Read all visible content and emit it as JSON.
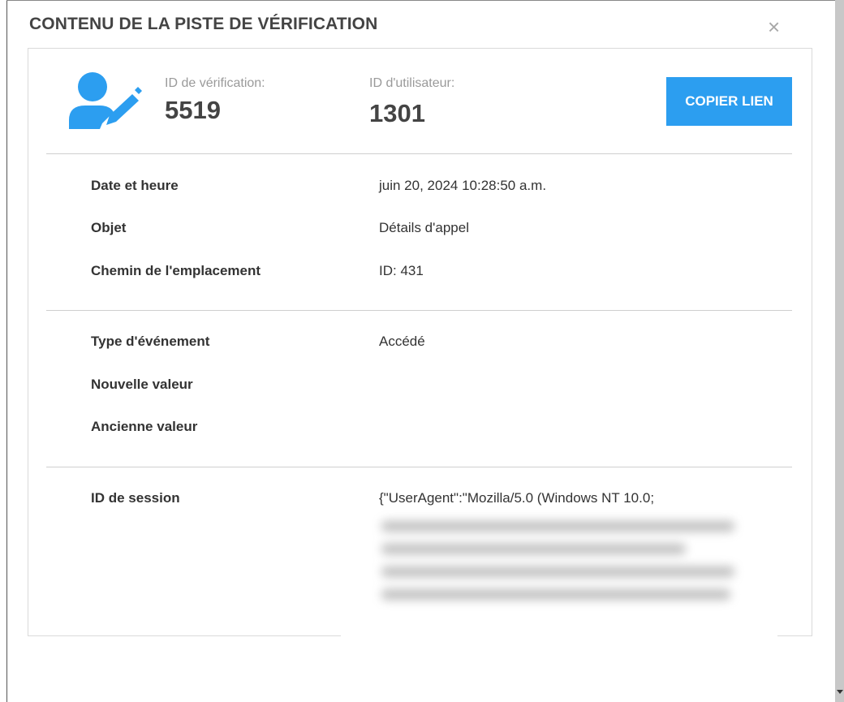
{
  "dialog": {
    "title": "CONTENU DE LA PISTE DE VÉRIFICATION",
    "close_glyph": "×"
  },
  "header": {
    "icon": "user-edit-icon",
    "verification_label": "ID de vérification:",
    "verification_id": "5519",
    "user_label": "ID d'utilisateur:",
    "user_id": "1301",
    "copy_button": "COPIER LIEN",
    "accent_color": "#2c9ef0"
  },
  "details": {
    "datetime": {
      "label": "Date et heure",
      "value": "juin 20, 2024 10:28:50 a.m."
    },
    "object": {
      "label": "Objet",
      "value": "Détails d'appel"
    },
    "location_path": {
      "label": "Chemin de l'emplacement",
      "value": "ID: 431"
    },
    "event_type": {
      "label": "Type d'événement",
      "value": "Accédé"
    },
    "new_value": {
      "label": "Nouvelle valeur",
      "value": ""
    },
    "old_value": {
      "label": "Ancienne valeur",
      "value": ""
    },
    "session_id": {
      "label": "ID de session",
      "value": "{\"UserAgent\":\"Mozilla/5.0 (Windows NT 10.0;"
    }
  }
}
